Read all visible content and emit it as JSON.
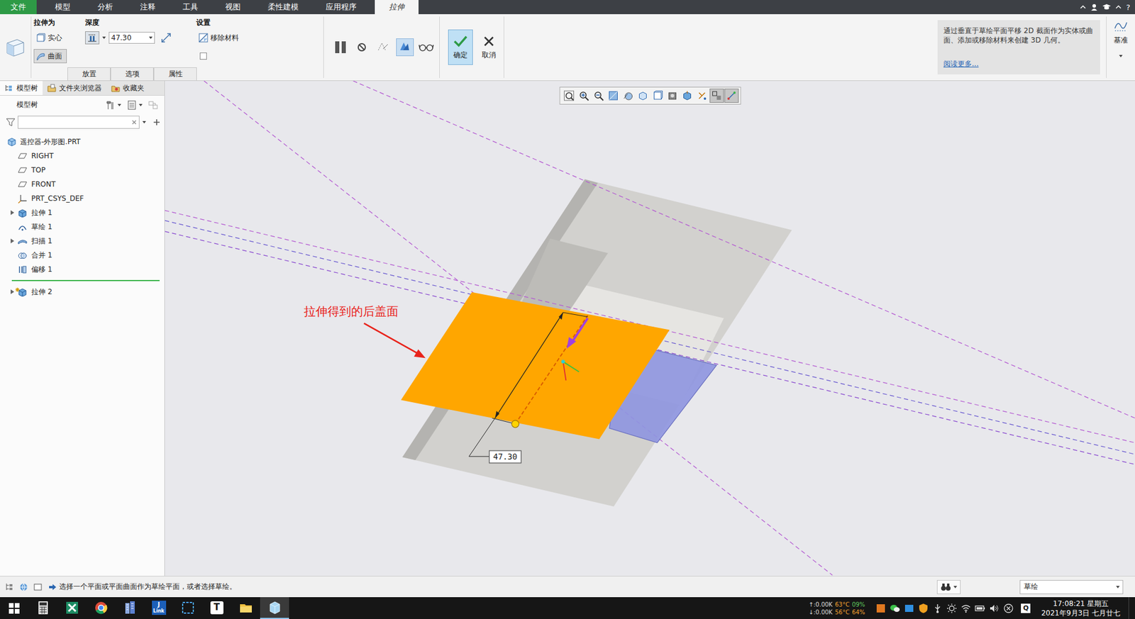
{
  "menu": {
    "file_menu": "文件",
    "tabs": [
      {
        "label": "模型",
        "selected": false
      },
      {
        "label": "分析",
        "selected": false
      },
      {
        "label": "注释",
        "selected": false
      },
      {
        "label": "工具",
        "selected": false
      },
      {
        "label": "视图",
        "selected": false
      },
      {
        "label": "柔性建模",
        "selected": false
      },
      {
        "label": "应用程序",
        "selected": false
      },
      {
        "label": "拉伸",
        "selected": true
      }
    ],
    "help": "?"
  },
  "ribbon": {
    "extrude_as": {
      "label": "拉伸为",
      "options": [
        {
          "label": "实心",
          "selected": false
        },
        {
          "label": "曲面",
          "selected": true
        }
      ]
    },
    "depth": {
      "label": "深度",
      "value": "47.30"
    },
    "settings": {
      "label": "设置",
      "remove_material": {
        "label": "移除材料",
        "checked": false
      },
      "thicken": {
        "checked": false
      }
    },
    "sub_tabs": [
      {
        "label": "放置"
      },
      {
        "label": "选项"
      },
      {
        "label": "属性"
      }
    ],
    "ok": "确定",
    "cancel": "取消",
    "help_text": "通过垂直于草绘平面平移 2D 截面作为实体或曲面、添加或移除材料来创建 3D 几何。",
    "read_more": "阅读更多...",
    "datum": "基准"
  },
  "left_panel": {
    "tabs": [
      {
        "label": "模型树",
        "selected": true
      },
      {
        "label": "文件夹浏览器",
        "selected": false
      },
      {
        "label": "收藏夹",
        "selected": false
      }
    ],
    "title": "模型树",
    "tree": {
      "root": {
        "label": "遥控器-外形图.PRT"
      },
      "children": [
        {
          "label": "RIGHT",
          "kind": "plane",
          "expandable": false,
          "new": false
        },
        {
          "label": "TOP",
          "kind": "plane",
          "expandable": false,
          "new": false
        },
        {
          "label": "FRONT",
          "kind": "plane",
          "expandable": false,
          "new": false
        },
        {
          "label": "PRT_CSYS_DEF",
          "kind": "csys",
          "expandable": false,
          "new": false
        },
        {
          "label": "拉伸 1",
          "kind": "extrude",
          "expandable": true,
          "new": false
        },
        {
          "label": "草绘 1",
          "kind": "sketch",
          "expandable": false,
          "new": false
        },
        {
          "label": "扫描 1",
          "kind": "sweep",
          "expandable": true,
          "new": false
        },
        {
          "label": "合并 1",
          "kind": "merge",
          "expandable": false,
          "new": false
        },
        {
          "label": "偏移 1",
          "kind": "offset",
          "expandable": false,
          "new": false
        },
        {
          "label": "拉伸 2",
          "kind": "extrude",
          "expandable": true,
          "new": true
        }
      ]
    }
  },
  "canvas": {
    "annotation": "拉伸得到的后盖面",
    "dimension": "47.30"
  },
  "status_bar": {
    "message": "选择一个平面或平面曲面作为草绘平面，或者选择草绘。",
    "filter": "草绘"
  },
  "taskbar": {
    "apps": [
      {
        "kind": "calculator",
        "active": false
      },
      {
        "kind": "xmind",
        "active": false
      },
      {
        "kind": "chrome",
        "active": false
      },
      {
        "kind": "building",
        "active": false
      },
      {
        "kind": "jlink",
        "active": false
      },
      {
        "kind": "snip",
        "active": false
      },
      {
        "kind": "typora",
        "active": false
      },
      {
        "kind": "explorer",
        "active": false
      },
      {
        "kind": "creo",
        "active": true
      }
    ],
    "jlink_glyph_top": "J",
    "jlink_glyph": "Link",
    "typora_glyph": "T",
    "net_up": "↑:0.00K",
    "temp1": "63°C",
    "load1": "09%",
    "net_down": "↓:0.00K",
    "temp2": "56°C",
    "load2": "64%",
    "tray_q": "Q",
    "time": "17:08:21 星期五",
    "date": "2021年9月3日 七月廿七"
  }
}
